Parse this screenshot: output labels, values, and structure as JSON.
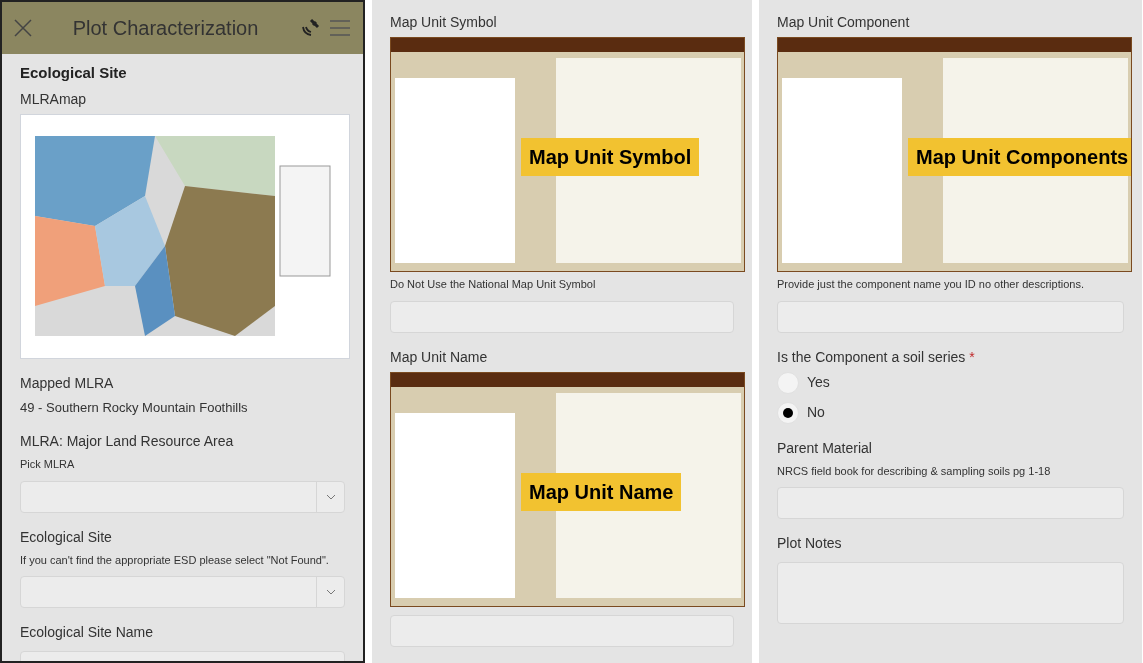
{
  "panels": [
    {
      "header": {
        "title": "Plot Characterization"
      },
      "items": [
        {
          "kind": "section",
          "label": "Ecological Site"
        },
        {
          "kind": "field",
          "label": "MLRAmap",
          "image": {
            "kind": "map"
          }
        },
        {
          "kind": "field",
          "label": "Mapped MLRA",
          "value": "49 - Southern Rocky Mountain Foothills"
        },
        {
          "kind": "field",
          "label": "MLRA: Major Land Resource Area",
          "hint": "Pick MLRA",
          "control": {
            "kind": "select"
          }
        },
        {
          "kind": "field",
          "label": "Ecological Site",
          "hint": "If you can't find the appropriate ESD please select \"Not Found\".",
          "control": {
            "kind": "select"
          }
        },
        {
          "kind": "field",
          "label": "Ecological Site Name",
          "control": {
            "kind": "input"
          }
        }
      ]
    },
    {
      "items": [
        {
          "kind": "field",
          "label": "Map Unit Symbol",
          "image": {
            "kind": "screenshot",
            "callout": "Map Unit Symbol"
          },
          "hint": "Do Not Use the National Map Unit Symbol",
          "control": {
            "kind": "input"
          }
        },
        {
          "kind": "field",
          "label": "Map Unit Name",
          "image": {
            "kind": "screenshot",
            "callout": "Map Unit Name"
          },
          "control": {
            "kind": "input"
          }
        }
      ]
    },
    {
      "items": [
        {
          "kind": "field",
          "label": "Map Unit Component",
          "image": {
            "kind": "screenshot",
            "callout": "Map Unit Components"
          },
          "hint": "Provide just the component name you ID no other descriptions.",
          "control": {
            "kind": "input"
          }
        },
        {
          "kind": "field",
          "label": "Is the Component a soil series",
          "required_mark": "*",
          "control": {
            "kind": "radio",
            "options": [
              {
                "label": "Yes",
                "selected": false
              },
              {
                "label": "No",
                "selected": true
              }
            ]
          }
        },
        {
          "kind": "field",
          "label": "Parent Material",
          "hint": "NRCS field book for describing & sampling soils pg 1-18",
          "control": {
            "kind": "input"
          }
        },
        {
          "kind": "field",
          "label": "Plot Notes",
          "control": {
            "kind": "textarea"
          }
        }
      ]
    }
  ]
}
